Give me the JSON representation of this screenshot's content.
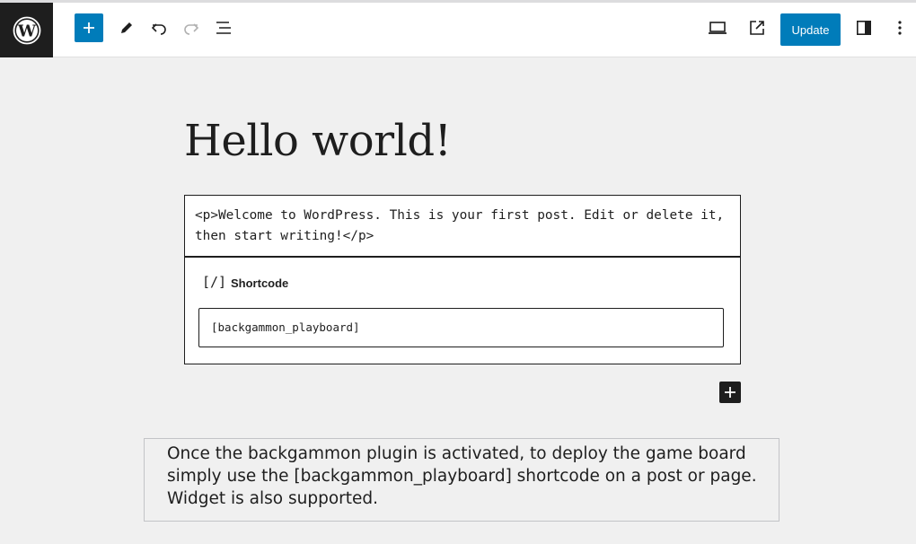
{
  "toolbar": {
    "logo": "wordpress-logo",
    "add_block_icon": "plus-icon",
    "tools_icon": "pencil-icon",
    "undo_icon": "undo-icon",
    "redo_icon": "redo-icon",
    "list_view_icon": "list-view-icon",
    "preview_icon": "laptop-icon",
    "view_post_icon": "external-link-icon",
    "update_label": "Update",
    "settings_icon": "sidebar-toggle-icon",
    "options_icon": "more-vertical-icon"
  },
  "post": {
    "title": "Hello world!",
    "html_block": "<p>Welcome to WordPress. This is your first post. Edit or delete it, then start writing!</p>",
    "shortcode_block": {
      "icon_text": "[/]",
      "label": "Shortcode",
      "value": "[backgammon_playboard]"
    },
    "add_block_icon": "plus-icon"
  },
  "notice": {
    "text": "Once the backgammon plugin is activated, to deploy the game board simply use the [backgammon_playboard] shortcode on a post or page. Widget is also supported."
  },
  "colors": {
    "accent": "#007cba",
    "dark": "#1e1e1e",
    "canvas": "#f0f0f0"
  }
}
